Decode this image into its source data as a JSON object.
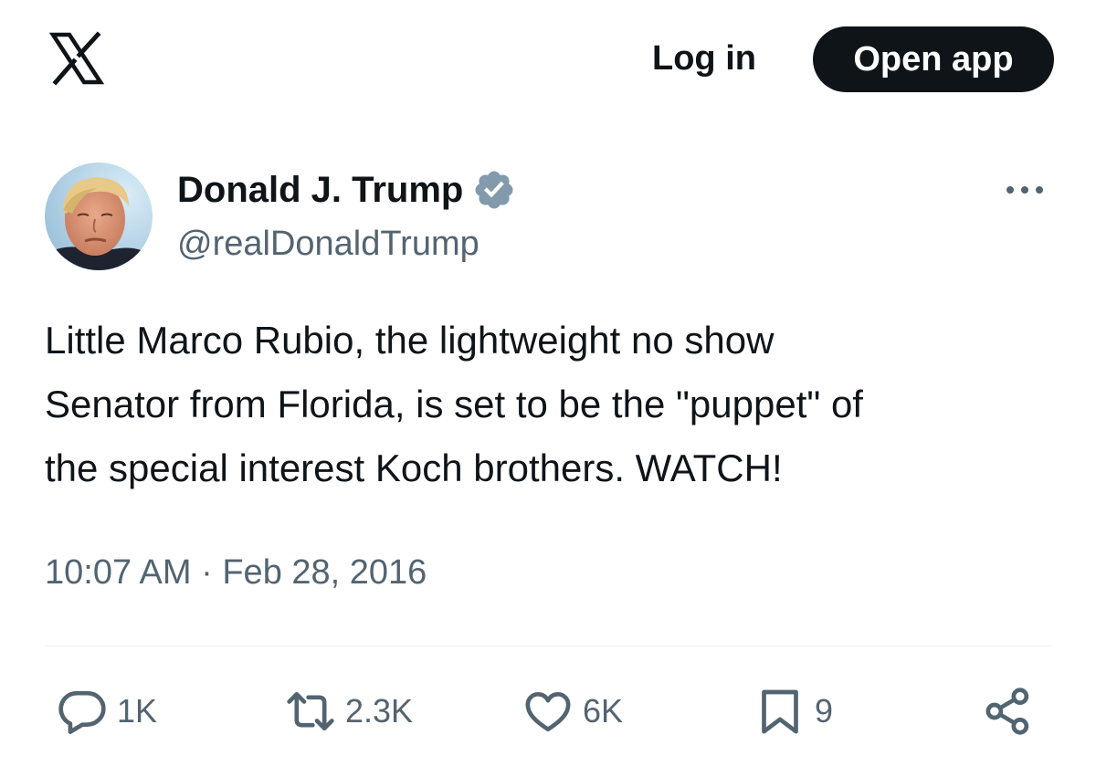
{
  "header": {
    "logo_icon": "x-logo-icon",
    "login_label": "Log in",
    "open_app_label": "Open app"
  },
  "author": {
    "display_name": "Donald J. Trump",
    "handle": "@realDonaldTrump",
    "verified": true,
    "verified_color": "#829aab"
  },
  "tweet": {
    "text": "Little Marco Rubio, the lightweight no show\nSenator from Florida, is set to be the \"puppet\" of\nthe special interest Koch brothers. WATCH!",
    "time": "10:07 AM",
    "separator": "·",
    "date": "Feb 28, 2016"
  },
  "actions": {
    "reply": {
      "icon": "reply-icon",
      "count": "1K"
    },
    "repost": {
      "icon": "repost-icon",
      "count": "2.3K"
    },
    "like": {
      "icon": "heart-icon",
      "count": "6K"
    },
    "bookmark": {
      "icon": "bookmark-icon",
      "count": "9"
    },
    "share": {
      "icon": "share-icon"
    }
  },
  "colors": {
    "text_primary": "#0f1419",
    "text_secondary": "#536471",
    "button_bg": "#0f1419",
    "divider": "#eff3f4"
  }
}
